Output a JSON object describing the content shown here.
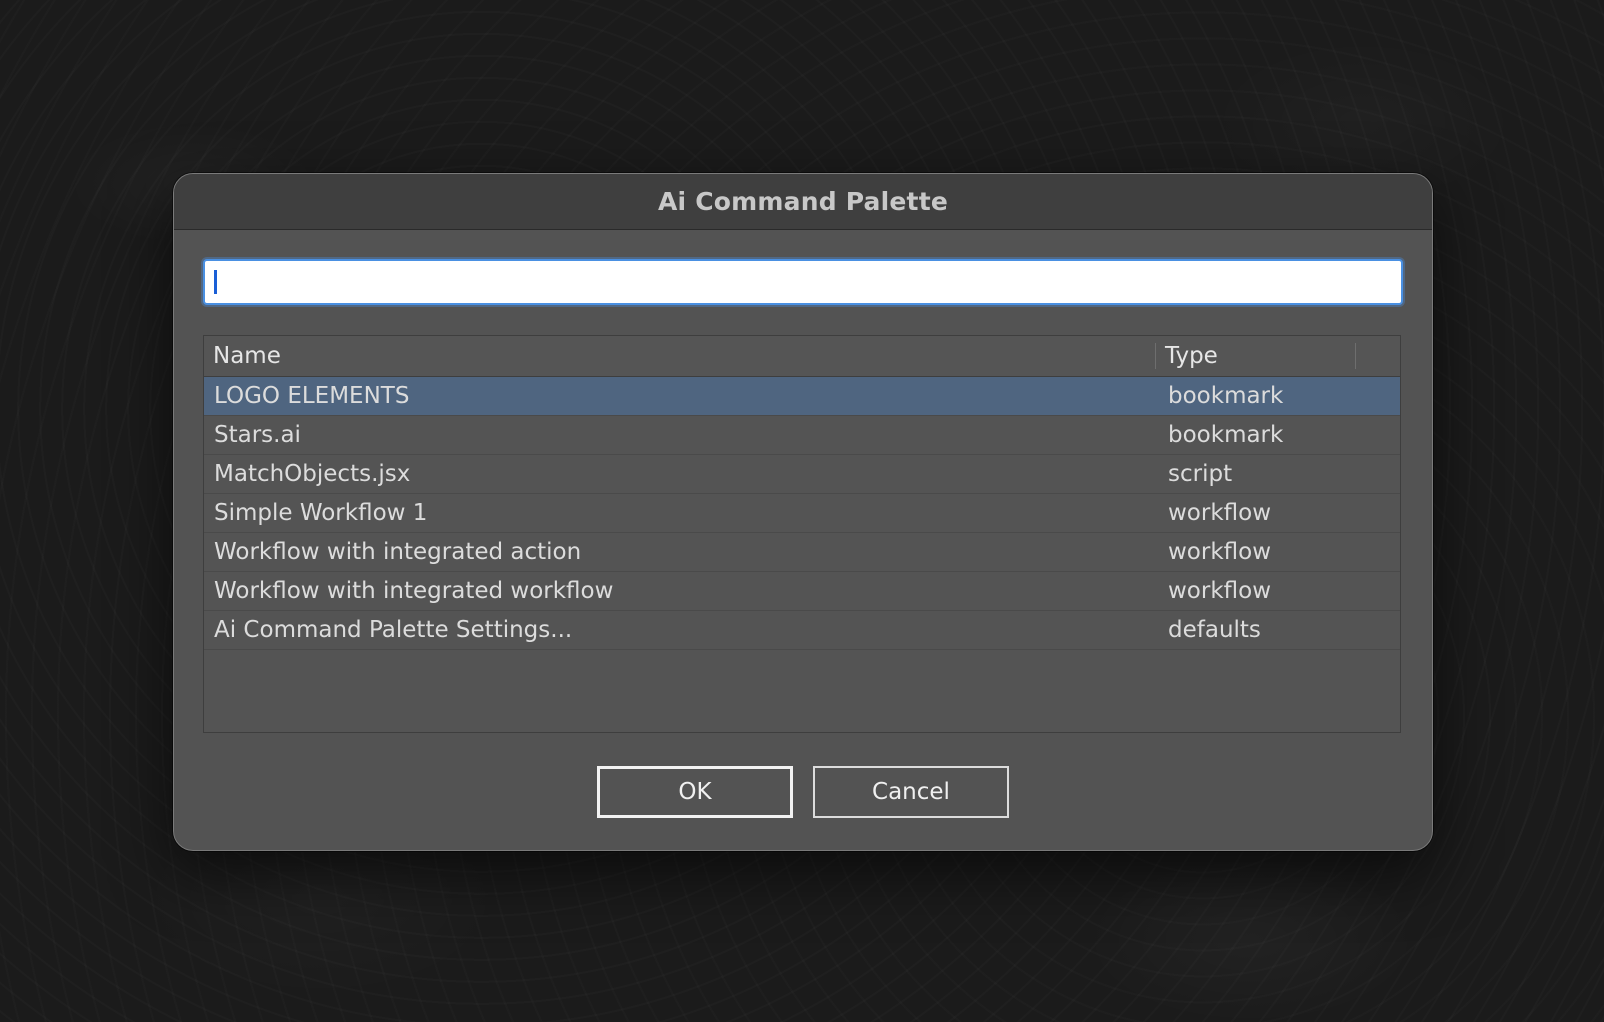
{
  "window": {
    "title": "Ai Command Palette"
  },
  "search": {
    "value": "",
    "placeholder": ""
  },
  "table": {
    "columns": [
      "Name",
      "Type"
    ],
    "rows": [
      {
        "name": "LOGO ELEMENTS",
        "type": "bookmark",
        "selected": true
      },
      {
        "name": "Stars.ai",
        "type": "bookmark",
        "selected": false
      },
      {
        "name": "MatchObjects.jsx",
        "type": "script",
        "selected": false
      },
      {
        "name": "Simple Workflow 1",
        "type": "workflow",
        "selected": false
      },
      {
        "name": "Workflow with integrated action",
        "type": "workflow",
        "selected": false
      },
      {
        "name": "Workflow with integrated workflow",
        "type": "workflow",
        "selected": false
      },
      {
        "name": "Ai Command Palette Settings...",
        "type": "defaults",
        "selected": false
      }
    ]
  },
  "buttons": {
    "ok_label": "OK",
    "cancel_label": "Cancel"
  },
  "colors": {
    "dialog_bg": "#535353",
    "titlebar_bg": "#3f3f3f",
    "selection": "#4f6580",
    "focus_ring": "#4a90e2"
  }
}
